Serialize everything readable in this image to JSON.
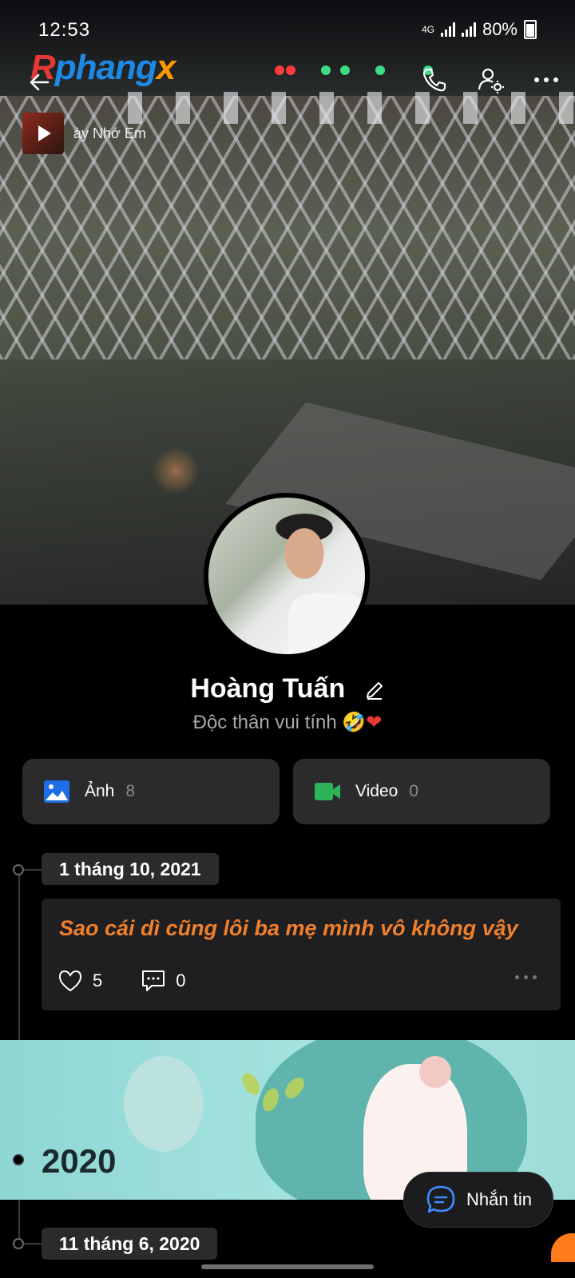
{
  "status": {
    "time": "12:53",
    "network": "4G",
    "battery": "80%"
  },
  "header": {
    "logo_part1": "R",
    "logo_part2": "phang",
    "logo_part3": "x",
    "music_title": "ày Nhớ Em"
  },
  "profile": {
    "name": "Hoàng Tuấn",
    "bio": "Độc thân vui tính",
    "bio_emoji1": "🤣",
    "bio_emoji2": "❤"
  },
  "media": {
    "photos_label": "Ảnh",
    "photos_count": "8",
    "videos_label": "Video",
    "videos_count": "0"
  },
  "timeline": {
    "date1": "1 tháng 10, 2021",
    "post": {
      "text": "Sao cái dì cũng lôi ba mẹ mình vô không vậy",
      "likes": "5",
      "comments": "0"
    },
    "year": "2020",
    "date2": "11 tháng 6, 2020"
  },
  "chat": {
    "label": "Nhắn tin"
  },
  "colors": {
    "accent_orange": "#f07f2b",
    "photo_icon": "#1e6fe5",
    "video_icon": "#2fb35a"
  }
}
